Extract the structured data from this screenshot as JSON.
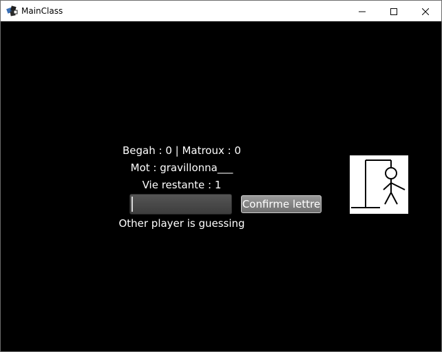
{
  "window": {
    "title": "MainClass",
    "icon": "java-app-icon",
    "controls": [
      "minimize-icon",
      "maximize-icon",
      "close-icon"
    ]
  },
  "game": {
    "score": "Begah : 0 | Matroux : 0",
    "word": "Mot : gravillonna___",
    "lives": "Vie restante : 1",
    "letter_input_value": "",
    "confirm_label": "Confirme lettre",
    "status": "Other player is guessing"
  },
  "hangman": {
    "icon": "hangman-figure",
    "errors_shown": "full-figure"
  },
  "colors": {
    "background": "#000000",
    "text": "#ffffff",
    "titlebar": "#ffffff"
  }
}
